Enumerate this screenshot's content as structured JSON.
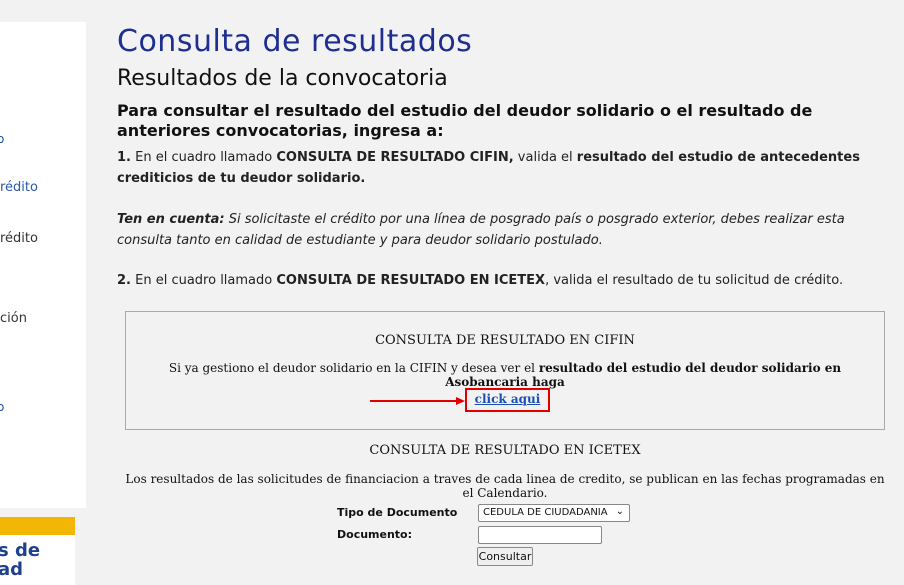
{
  "sidebar": {
    "items": [
      {
        "label": "o",
        "active": false
      },
      {
        "label": "rédito",
        "active": true
      },
      {
        "label": "rédito",
        "active": false
      },
      {
        "label": "ción",
        "active": false
      },
      {
        "label": "o",
        "active": false
      }
    ],
    "banner_text_line1": "s de",
    "banner_text_line2": "ad",
    "banner_accent": "#f2b705"
  },
  "main": {
    "title": "Consulta de resultados",
    "subtitle": "Resultados de la convocatoria",
    "intro": "Para consultar el resultado del estudio del deudor solidario o el resultado de anteriores convocatorias, ingresa a:",
    "step1": {
      "number": "1.",
      "t1": " En el cuadro llamado ",
      "b1": "CONSULTA DE RESULTADO CIFIN,",
      "t2": " valida el ",
      "b2": "resultado del estudio de antecedentes crediticios de tu deudor solidario."
    },
    "note": {
      "label": "Ten en cuenta:",
      "text": " Si solicitaste el crédito por una línea de posgrado país o posgrado exterior, debes realizar esta consulta tanto en calidad de estudiante y para deudor solidario postulado."
    },
    "step2": {
      "number": "2.",
      "t1": " En el cuadro llamado ",
      "b1": "CONSULTA DE RESULTADO EN ICETEX",
      "t2": ", valida el resultado de tu solicitud de crédito."
    }
  },
  "cifin": {
    "title": "CONSULTA DE RESULTADO EN CIFIN",
    "text_plain": "Si ya gestiono el deudor solidario en la CIFIN y desea ver el ",
    "text_bold": "resultado del estudio del deudor solidario en Asobancaria haga",
    "link_label": "click aqui",
    "highlight_color": "#e00000"
  },
  "icetex": {
    "title": "CONSULTA DE RESULTADO EN ICETEX",
    "text": "Los resultados de las solicitudes de financiacion a traves de cada linea de credito, se publican en las fechas programadas en el Calendario.",
    "form": {
      "doc_type_label": "Tipo de Documento",
      "doc_type_value": "CEDULA DE CIUDADANIA",
      "doc_label": "Documento:",
      "doc_value": "",
      "submit_label": "Consultar"
    }
  }
}
